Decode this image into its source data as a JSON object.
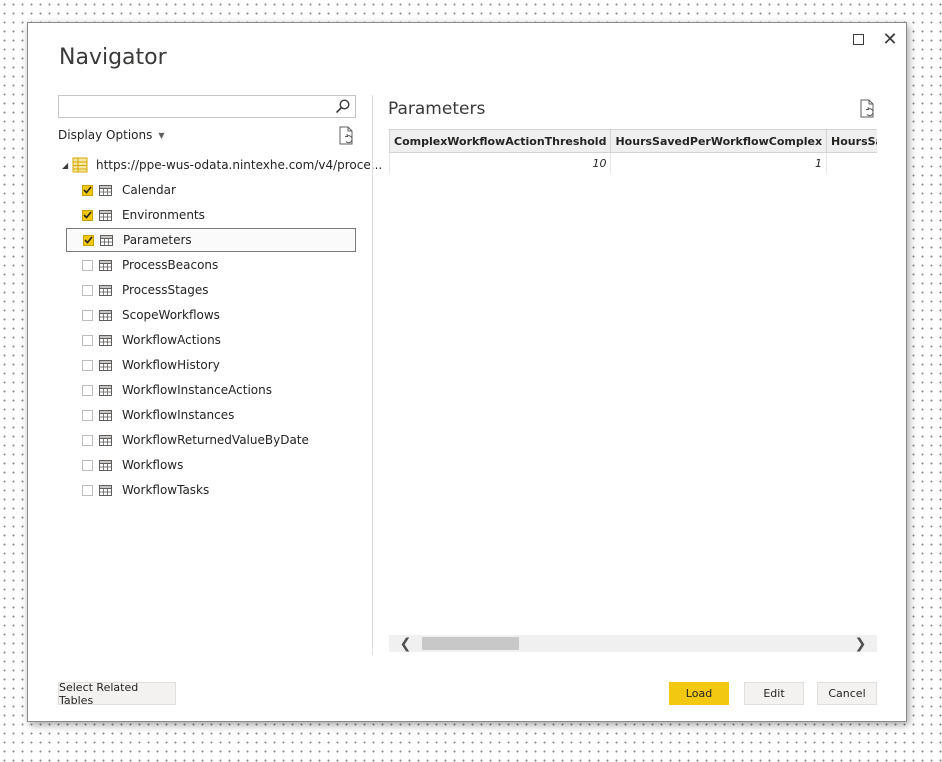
{
  "dialog": {
    "title": "Navigator",
    "colors": {
      "accent": "#f2c811",
      "border": "#8a8a8a"
    }
  },
  "search": {
    "value": "",
    "placeholder": ""
  },
  "display_options": {
    "label": "Display Options"
  },
  "tree": {
    "root": {
      "label": "https://ppe-wus-odata.nintexhe.com/v4/proce...",
      "icon": "database-icon"
    },
    "items": [
      {
        "label": "Calendar",
        "checked": true,
        "selected": false
      },
      {
        "label": "Environments",
        "checked": true,
        "selected": false
      },
      {
        "label": "Parameters",
        "checked": true,
        "selected": true
      },
      {
        "label": "ProcessBeacons",
        "checked": false,
        "selected": false
      },
      {
        "label": "ProcessStages",
        "checked": false,
        "selected": false
      },
      {
        "label": "ScopeWorkflows",
        "checked": false,
        "selected": false
      },
      {
        "label": "WorkflowActions",
        "checked": false,
        "selected": false
      },
      {
        "label": "WorkflowHistory",
        "checked": false,
        "selected": false
      },
      {
        "label": "WorkflowInstanceActions",
        "checked": false,
        "selected": false
      },
      {
        "label": "WorkflowInstances",
        "checked": false,
        "selected": false
      },
      {
        "label": "WorkflowReturnedValueByDate",
        "checked": false,
        "selected": false
      },
      {
        "label": "Workflows",
        "checked": false,
        "selected": false
      },
      {
        "label": "WorkflowTasks",
        "checked": false,
        "selected": false
      }
    ]
  },
  "preview": {
    "title": "Parameters",
    "columns": [
      "ComplexWorkflowActionThreshold",
      "HoursSavedPerWorkflowComplex",
      "HoursSavedPerWorkflo"
    ],
    "rows": [
      [
        "10",
        "1",
        ""
      ]
    ]
  },
  "buttons": {
    "select_related": "Select Related Tables",
    "load": "Load",
    "edit": "Edit",
    "cancel": "Cancel"
  }
}
